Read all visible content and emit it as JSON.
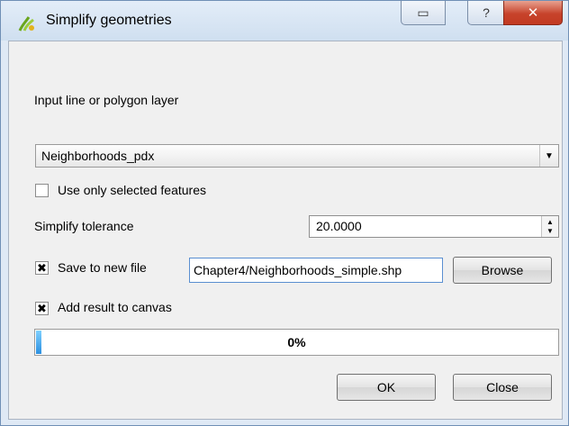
{
  "window": {
    "title": "Simplify geometries",
    "restore_glyph": "▭",
    "help_glyph": "?",
    "close_glyph": "✕",
    "icon": "simplify-plugin-icon"
  },
  "form": {
    "input_layer_label": "Input line or polygon layer",
    "input_layer_value": "Neighborhoods_pdx",
    "selected_only_label": "Use only selected features",
    "selected_only_checked": false,
    "tolerance_label": "Simplify tolerance",
    "tolerance_value": "20.0000",
    "save_label": "Save to new file",
    "save_checked": true,
    "save_path": "Chapter4/Neighborhoods_simple.shp",
    "browse_label": "Browse",
    "add_canvas_label": "Add result to canvas",
    "add_canvas_checked": true
  },
  "progress": {
    "value": 0.01,
    "text": "0%"
  },
  "buttons": {
    "ok": "OK",
    "close": "Close"
  },
  "colors": {
    "title_bg": "#dfe9f5",
    "close_button": "#c7432b",
    "progress_fill": "#2b8fe0",
    "focus_border": "#5a8fd1"
  }
}
